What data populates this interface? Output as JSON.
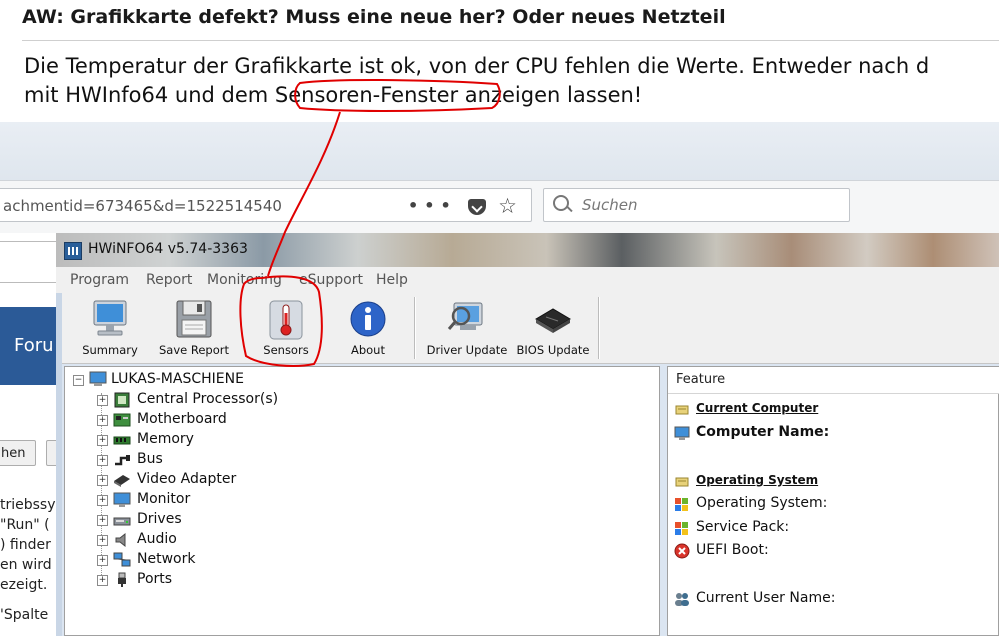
{
  "post": {
    "title": "AW: Grafikkarte defekt? Muss eine neue her? Oder neues Netzteil",
    "line1": "Die Temperatur der Grafikkarte ist ok, von der CPU fehlen die Werte. Entweder nach d",
    "line2_a": "mit HWInfo64 und dem ",
    "line2_highlight": "Sensoren-Fenster",
    "line2_b": " anzeigen lassen!"
  },
  "browser": {
    "url": "achmentid=673465&d=1522514540",
    "search_placeholder": "Suchen",
    "page_actions_label": "•••"
  },
  "background_page": {
    "forum_label": "Foru",
    "button1": "hen",
    "lines": [
      "triebssy",
      "\"Run\" (",
      ") finder",
      "en wird",
      "ezeigt."
    ],
    "last_line": "'Spalte"
  },
  "hwinfo": {
    "title": "HWiNFO64 v5.74-3363",
    "menu": [
      "Program",
      "Report",
      "Monitoring",
      "eSupport",
      "Help"
    ],
    "toolbar": [
      {
        "label": "Summary",
        "icon": "monitor-icon"
      },
      {
        "label": "Save Report",
        "icon": "floppy-icon"
      },
      {
        "label": "Sensors",
        "icon": "thermometer-icon"
      },
      {
        "label": "About",
        "icon": "info-icon"
      },
      {
        "label": "Driver Update",
        "icon": "driver-update-icon"
      },
      {
        "label": "BIOS Update",
        "icon": "chip-icon"
      }
    ],
    "tree": {
      "root": "LUKAS-MASCHIENE",
      "items": [
        "Central Processor(s)",
        "Motherboard",
        "Memory",
        "Bus",
        "Video Adapter",
        "Monitor",
        "Drives",
        "Audio",
        "Network",
        "Ports"
      ]
    },
    "features": {
      "header": "Feature",
      "current_computer": "Current Computer",
      "computer_name": "Computer Name:",
      "operating_system_section": "Operating System",
      "operating_system": "Operating System:",
      "service_pack": "Service Pack:",
      "uefi_boot": "UEFI Boot:",
      "current_user": "Current User Name:"
    }
  },
  "colors": {
    "annotation": "#e00000",
    "forum_blue": "#2b5a97",
    "hw_frame": "#dbe5f1"
  }
}
